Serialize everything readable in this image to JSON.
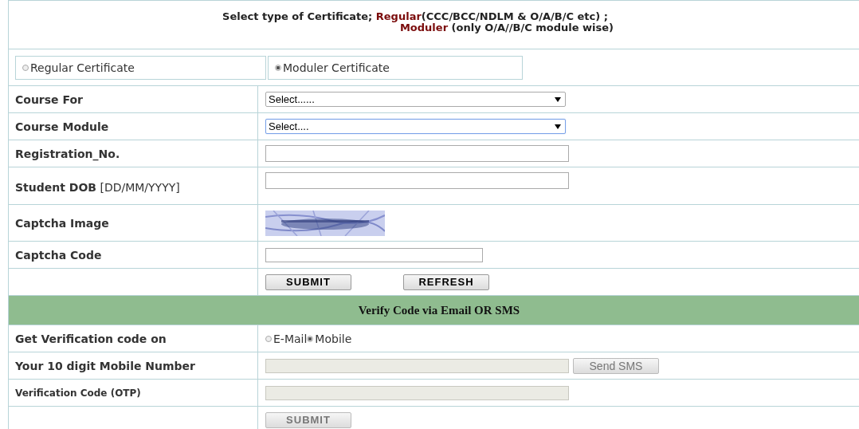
{
  "header": {
    "line1": [
      {
        "text": "Select type of Certificate; ",
        "kind": "plain"
      },
      {
        "text": "Regular",
        "kind": "highlight"
      },
      {
        "text": "(CCC/BCC/NDLM & O/A/B/C etc) ;",
        "kind": "plain"
      }
    ],
    "line2": [
      {
        "text": "Moduler",
        "kind": "highlight"
      },
      {
        "text": " (only O/A//B/C module wise)",
        "kind": "plain"
      }
    ]
  },
  "certificate_options": [
    {
      "label": "Regular Certificate",
      "selected": false
    },
    {
      "label": "Moduler Certificate",
      "selected": true
    }
  ],
  "rows": [
    {
      "kind": "select",
      "label": "Course For",
      "value": "Select......",
      "focused": false
    },
    {
      "kind": "select",
      "label": "Course Module",
      "value": "Select....",
      "focused": true
    },
    {
      "kind": "input",
      "label": "Registration_No.",
      "disabled": false
    },
    {
      "kind": "input",
      "label": "Student DOB",
      "note": "[DD/MM/YYYY]",
      "disabled": false,
      "tall": true
    },
    {
      "kind": "picture",
      "label": "Captcha Image"
    },
    {
      "kind": "input",
      "label": "Captcha Code",
      "disabled": false,
      "short": true
    },
    {
      "kind": "buttons",
      "buttons": [
        {
          "label": "SUBMIT",
          "disabled": false
        },
        {
          "label": "REFRESH",
          "disabled": false
        }
      ]
    },
    {
      "kind": "section",
      "title": "Verify Code via Email OR SMS"
    },
    {
      "kind": "radio",
      "label": "Get Verification code on",
      "options": [
        {
          "label": "E-Mail",
          "selected": false
        },
        {
          "label": "Mobile",
          "selected": true
        }
      ]
    },
    {
      "kind": "input",
      "label": "Your 10 digit Mobile Number",
      "disabled": true,
      "button": {
        "label": "Send SMS",
        "disabled": true
      }
    },
    {
      "kind": "input",
      "label": "Verification Code (OTP)",
      "disabled": true,
      "small_label": true
    },
    {
      "kind": "buttons",
      "buttons": [
        {
          "label": "SUBMIT",
          "disabled": true
        }
      ]
    }
  ]
}
